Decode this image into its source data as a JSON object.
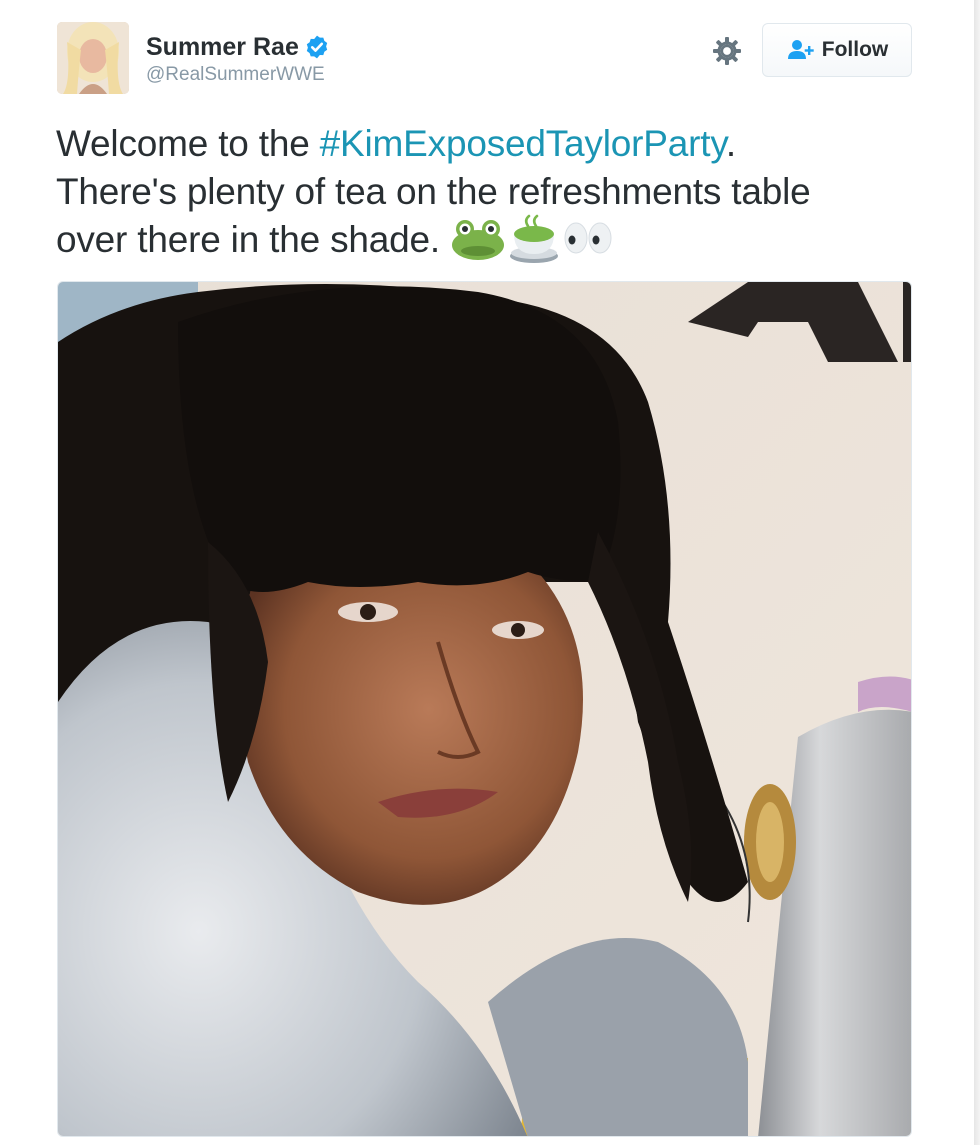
{
  "user": {
    "display_name": "Summer Rae",
    "handle": "@RealSummerWWE",
    "verified": true,
    "avatar_icon": "profile-photo"
  },
  "actions": {
    "settings_icon": "gear-icon",
    "follow_label": "Follow",
    "follow_icon": "add-user-icon"
  },
  "tweet": {
    "line1_before": "Welcome to the ",
    "hashtag": "#KimExposedTaylorParty",
    "line1_after": ".",
    "line2": "There's plenty of tea on the refreshments table",
    "line3": "over there in the shade.",
    "emojis": [
      "frog-face-emoji",
      "tea-cup-emoji",
      "eyes-emoji"
    ]
  },
  "media": {
    "type": "photo",
    "description_icon": "attached-photo"
  },
  "colors": {
    "hashtag": "#1b95b4",
    "verified": "#1da1f2",
    "handle": "#8899a6",
    "text": "#292f33"
  }
}
